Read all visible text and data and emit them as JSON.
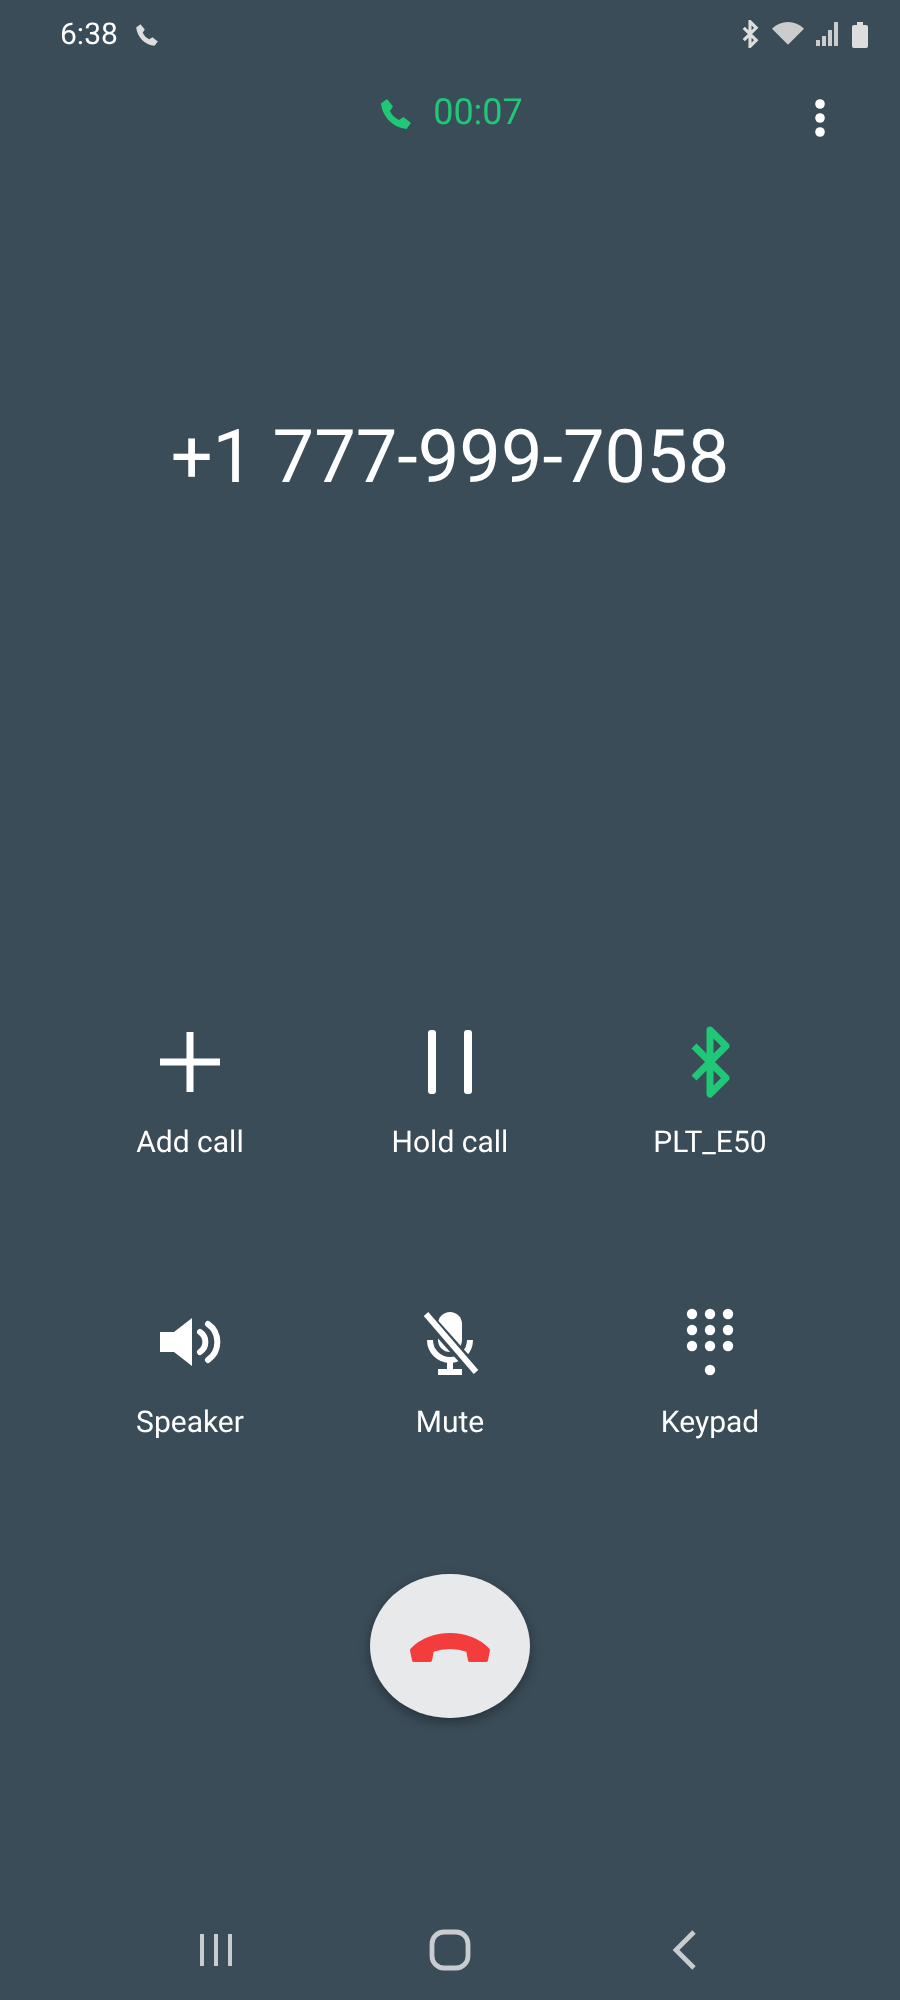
{
  "status_bar": {
    "time": "6:38"
  },
  "call": {
    "duration": "00:07",
    "number": "+1 777-999-7058"
  },
  "actions": [
    {
      "kind": "add",
      "label": "Add call",
      "on": false
    },
    {
      "kind": "hold",
      "label": "Hold call",
      "on": false
    },
    {
      "kind": "bluetooth",
      "label": "PLT_E50",
      "on": true
    },
    {
      "kind": "speaker",
      "label": "Speaker",
      "on": false
    },
    {
      "kind": "mute",
      "label": "Mute",
      "on": false
    },
    {
      "kind": "keypad",
      "label": "Keypad",
      "on": false
    }
  ]
}
